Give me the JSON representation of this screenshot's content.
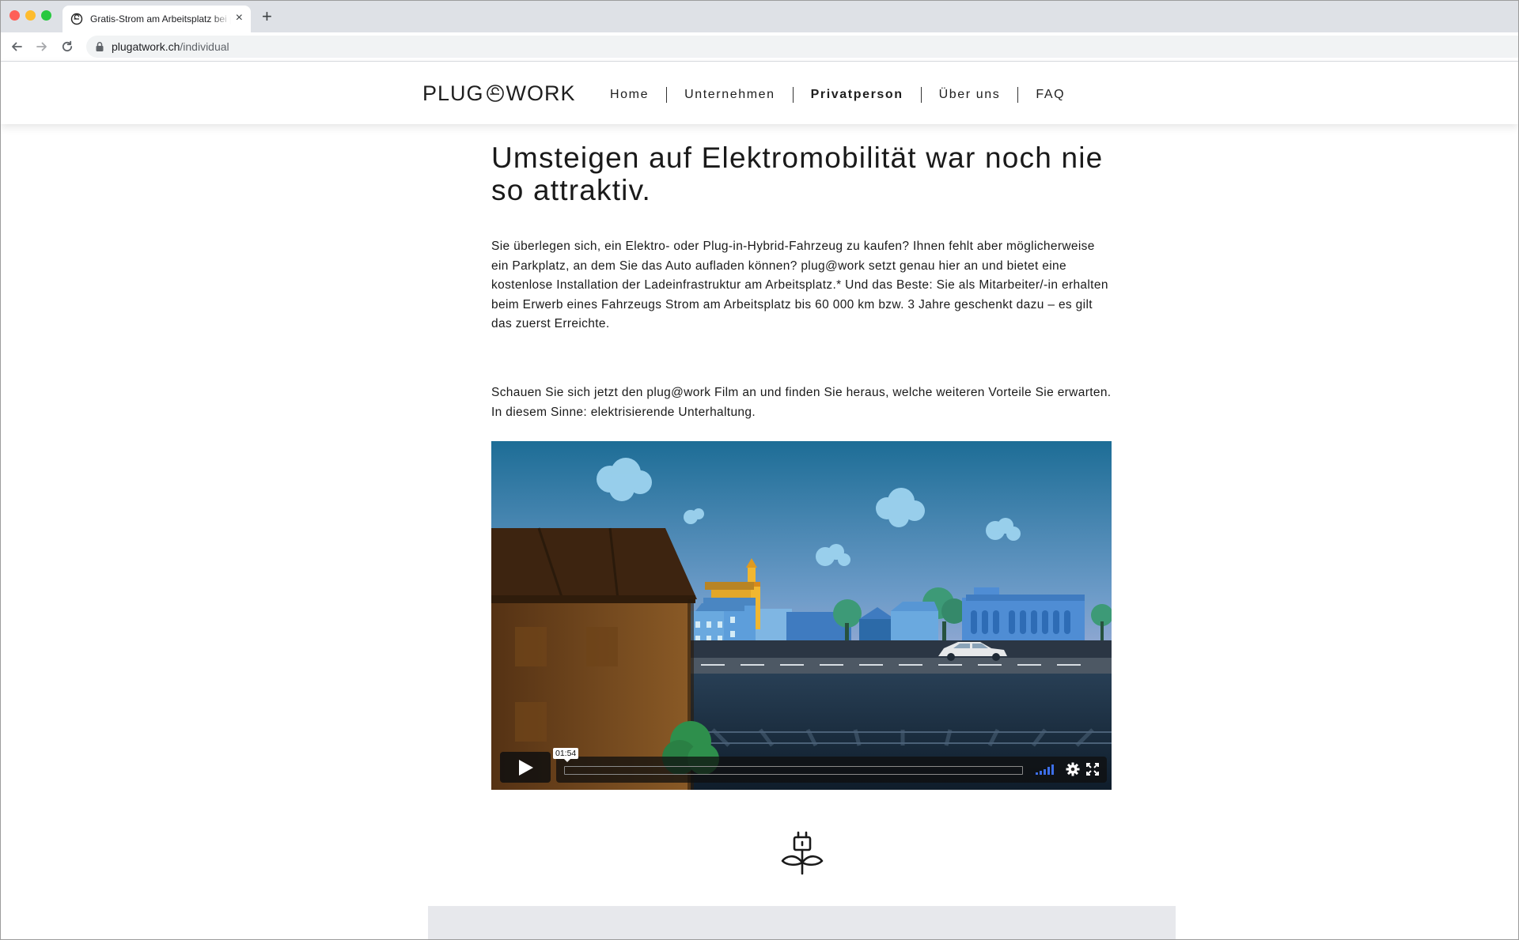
{
  "browser": {
    "tab_title": "Gratis-Strom am Arbeitsplatz bei plug@work",
    "url_host": "plugatwork.ch",
    "url_path": "/individual"
  },
  "header": {
    "logo_left": "PLUG",
    "logo_right": "WORK",
    "nav": [
      {
        "label": "Home",
        "active": false
      },
      {
        "label": "Unternehmen",
        "active": false
      },
      {
        "label": "Privatperson",
        "active": true
      },
      {
        "label": "Über uns",
        "active": false
      },
      {
        "label": "FAQ",
        "active": false
      }
    ]
  },
  "main": {
    "headline": "Umsteigen auf Elektromobilität war noch nie so attraktiv.",
    "intro": "Sie überlegen sich, ein Elektro- oder Plug-in-Hybrid-Fahrzeug zu kaufen? Ihnen fehlt aber möglicherweise ein Parkplatz, an dem Sie das Auto aufladen können? plug@work setzt genau hier an und bietet eine kostenlose Installation der Ladeinfrastruktur am Arbeitsplatz.* Und das Beste: Sie als Mitarbeiter/-in erhalten beim Erwerb eines Fahrzeugs Strom am Arbeitsplatz bis 60 000 km bzw. 3 Jahre geschenkt dazu – es gilt das zuerst Erreichte.",
    "film_text": "Schauen Sie sich jetzt den plug@work Film an und finden Sie heraus, welche weiteren Vorteile Sie erwarten. In diesem Sinne: elektrisierende Unterhaltung."
  },
  "video": {
    "duration": "01:54"
  },
  "colors": {
    "accent_volume": "#3d6fe8",
    "footer_block": "#e7e8ec"
  },
  "icons": [
    "play-icon",
    "volume-icon",
    "settings-icon",
    "fullscreen-icon",
    "plug-icon",
    "lock-icon",
    "back-icon",
    "forward-icon",
    "reload-icon",
    "close-icon"
  ]
}
